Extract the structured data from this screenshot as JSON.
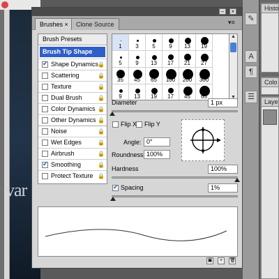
{
  "background": {
    "canvas_text": "var"
  },
  "right_dock": {
    "tabs": [
      {
        "label": "Histo"
      },
      {
        "label": "Colo"
      },
      {
        "label": "Laye"
      }
    ]
  },
  "panel": {
    "tabs": [
      {
        "label": "Brushes ×",
        "active": true
      },
      {
        "label": "Clone Source",
        "active": false
      }
    ],
    "brush_presets_label": "Brush Presets",
    "selected_item": "Brush Tip Shape",
    "options": [
      {
        "label": "Shape Dynamics",
        "checked": true
      },
      {
        "label": "Scattering",
        "checked": false
      },
      {
        "label": "Texture",
        "checked": false
      },
      {
        "label": "Dual Brush",
        "checked": false
      },
      {
        "label": "Color Dynamics",
        "checked": false
      },
      {
        "label": "Other Dynamics",
        "checked": false
      },
      {
        "label": "Noise",
        "checked": false
      },
      {
        "label": "Wet Edges",
        "checked": false
      },
      {
        "label": "Airbrush",
        "checked": false
      },
      {
        "label": "Smoothing",
        "checked": true
      },
      {
        "label": "Protect Texture",
        "checked": false
      }
    ],
    "brush_tips": [
      {
        "num": "1"
      },
      {
        "num": "3"
      },
      {
        "num": "5"
      },
      {
        "num": "9"
      },
      {
        "num": "13"
      },
      {
        "num": "19"
      },
      {
        "num": "5"
      },
      {
        "num": "9"
      },
      {
        "num": "13"
      },
      {
        "num": "17"
      },
      {
        "num": "21"
      },
      {
        "num": "27"
      },
      {
        "num": "35"
      },
      {
        "num": "45"
      },
      {
        "num": "65"
      },
      {
        "num": "100"
      },
      {
        "num": "200"
      },
      {
        "num": "300"
      },
      {
        "num": "9"
      },
      {
        "num": "13"
      },
      {
        "num": "19"
      },
      {
        "num": "17"
      },
      {
        "num": "45"
      },
      {
        "num": "65"
      }
    ],
    "diameter": {
      "label": "Diameter",
      "value": "1 px"
    },
    "flip_x": {
      "label": "Flip X",
      "checked": false
    },
    "flip_y": {
      "label": "Flip Y",
      "checked": false
    },
    "angle": {
      "label": "Angle:",
      "value": "0°"
    },
    "roundness": {
      "label": "Roundness:",
      "value": "100%"
    },
    "hardness": {
      "label": "Hardness",
      "value": "100%"
    },
    "spacing": {
      "label": "Spacing",
      "value": "1%",
      "checked": true
    },
    "menu_icon": "panel-menu-icon"
  }
}
